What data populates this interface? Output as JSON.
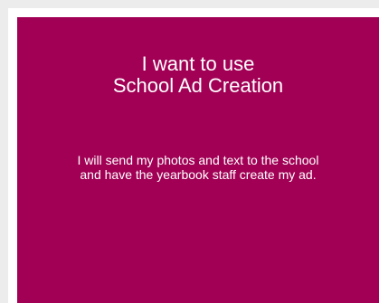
{
  "option_card": {
    "title_line_1": "I want to use",
    "title_line_2": "School Ad Creation",
    "description_line_1": "I will send my photos and text to the school",
    "description_line_2": "and have the yearbook staff create my ad.",
    "background_color": "#a10055",
    "text_color": "#ffffff"
  }
}
